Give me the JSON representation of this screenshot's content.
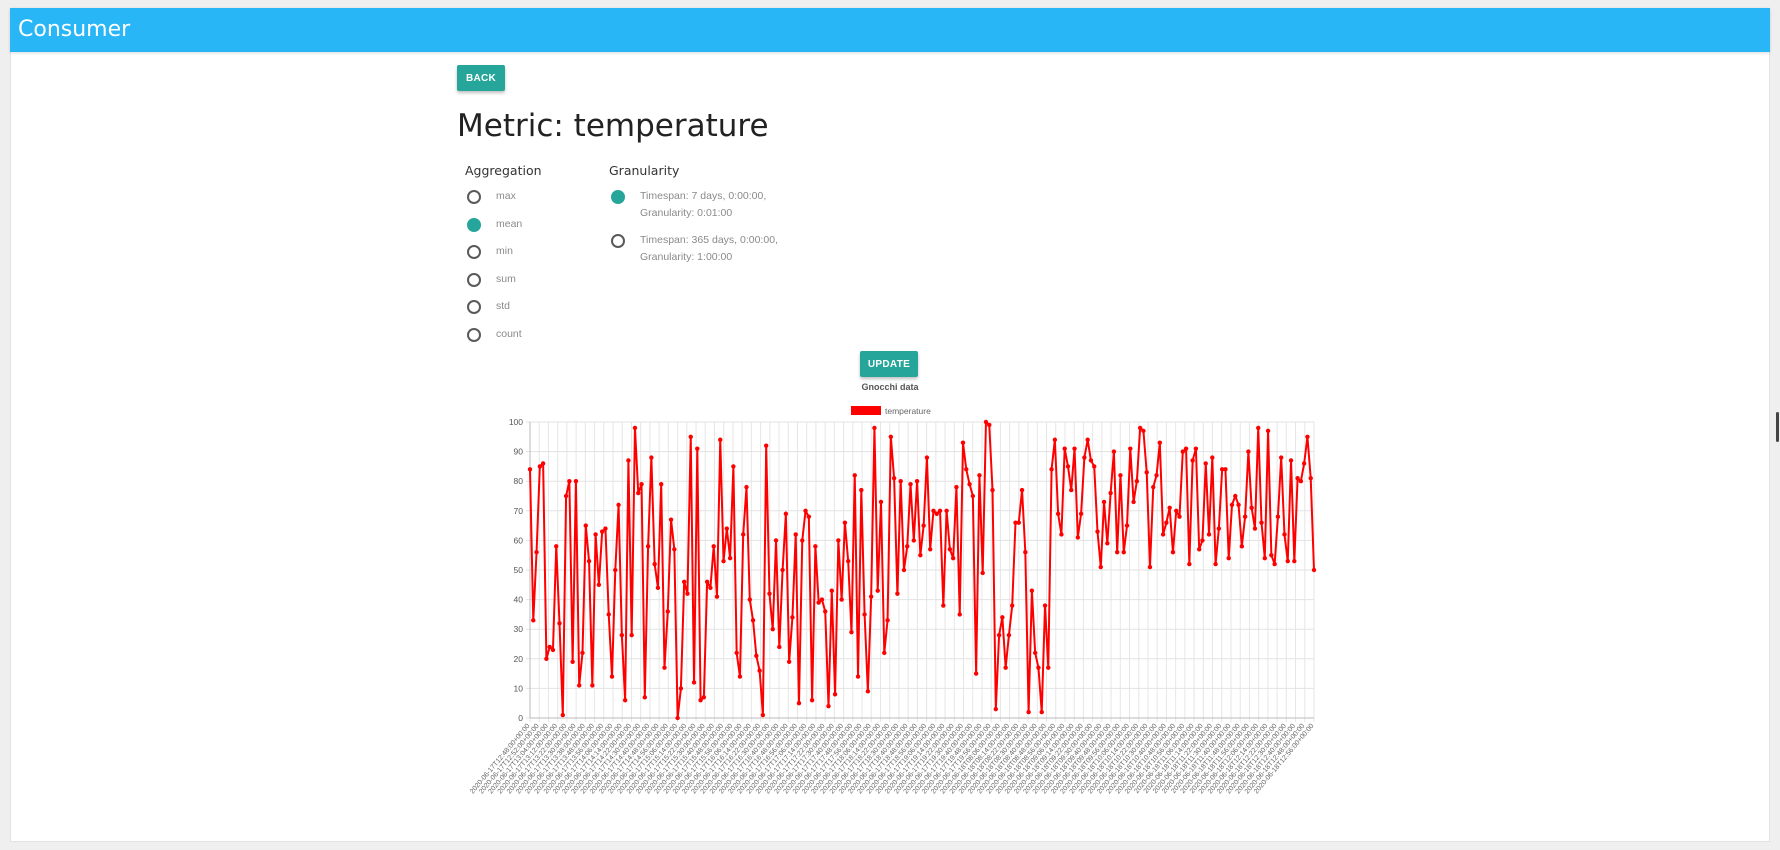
{
  "app": {
    "title": "Consumer"
  },
  "buttons": {
    "back": "BACK",
    "update": "UPDATE"
  },
  "page_title": "Metric: temperature",
  "aggregation": {
    "label": "Aggregation",
    "selected": "mean",
    "options": [
      "max",
      "mean",
      "min",
      "sum",
      "std",
      "count"
    ]
  },
  "granularity": {
    "label": "Granularity",
    "selected": 0,
    "options": [
      "Timespan: 7 days, 0:00:00, Granularity: 0:01:00",
      "Timespan: 365 days, 0:00:00, Granularity: 1:00:00"
    ]
  },
  "colors": {
    "topbar": "#29b6f6",
    "accent": "#26a69a",
    "series": "#ff0000"
  },
  "chart_data": {
    "type": "line",
    "title": "Gnocchi data",
    "legend": "top",
    "grid": true,
    "ylim": [
      0,
      100
    ],
    "yticks": [
      0,
      10,
      20,
      30,
      40,
      50,
      60,
      70,
      80,
      90,
      100
    ],
    "series": [
      {
        "name": "temperature",
        "color": "#ff0000",
        "values": [
          84,
          33,
          56,
          85,
          86,
          20,
          24,
          23,
          58,
          32,
          1,
          75,
          80,
          19,
          80,
          11,
          22,
          65,
          53,
          11,
          62,
          45,
          63,
          64,
          35,
          14,
          50,
          72,
          28,
          6,
          87,
          28,
          98,
          76,
          79,
          7,
          58,
          88,
          52,
          44,
          79,
          17,
          36,
          67,
          57,
          0,
          10,
          46,
          42,
          95,
          12,
          91,
          6,
          7,
          46,
          44,
          58,
          41,
          94,
          53,
          64,
          54,
          85,
          22,
          14,
          62,
          78,
          40,
          33,
          21,
          16,
          1,
          92,
          42,
          30,
          60,
          24,
          50,
          69,
          19,
          34,
          62,
          5,
          60,
          70,
          68,
          6,
          58,
          39,
          40,
          36,
          4,
          43,
          8,
          60,
          40,
          66,
          53,
          29,
          82,
          14,
          77,
          35,
          9,
          41,
          98,
          43,
          73,
          22,
          33,
          95,
          81,
          42,
          80,
          50,
          58,
          79,
          60,
          80,
          55,
          65,
          88,
          57,
          70,
          69,
          70,
          38,
          70,
          57,
          54,
          78,
          35,
          93,
          84,
          79,
          75,
          15,
          82,
          49,
          100,
          99,
          77,
          3,
          28,
          34,
          17,
          28,
          38,
          66,
          66,
          77,
          56,
          2,
          43,
          22,
          17,
          2,
          38,
          17,
          84,
          94,
          69,
          62,
          91,
          85,
          77,
          91,
          61,
          69,
          88,
          94,
          87,
          85,
          63,
          51,
          73,
          59,
          76,
          90,
          56,
          82,
          56,
          65,
          91,
          73,
          80,
          98,
          97,
          83,
          51,
          78,
          82,
          93,
          62,
          66,
          71,
          56,
          70,
          68,
          90,
          91,
          52,
          87,
          91,
          57,
          60,
          86,
          62,
          88,
          52,
          64,
          84,
          84,
          54,
          72,
          75,
          72,
          58,
          68,
          90,
          71,
          64,
          98,
          66,
          54,
          97,
          55,
          52,
          68,
          88,
          62,
          53,
          87,
          53,
          81,
          80,
          86,
          95,
          81,
          50
        ]
      }
    ],
    "x_labels": [
      "2020-06-17T12:48:00+00:00",
      "2020-06-17T12:52:00+00:00",
      "2020-06-17T13:04:00+00:00",
      "2020-06-17T13:12:00+00:00",
      "2020-06-17T13:22:00+00:00",
      "2020-06-17T13:30:00+00:00",
      "2020-06-17T13:38:00+00:00",
      "2020-06-17T13:48:00+00:00",
      "2020-06-17T13:56:00+00:00",
      "2020-06-17T14:06:00+00:00",
      "2020-06-17T14:14:00+00:00",
      "2020-06-17T14:22:00+00:00",
      "2020-06-17T14:30:00+00:00",
      "2020-06-17T14:40:00+00:00",
      "2020-06-17T14:48:00+00:00",
      "2020-06-17T14:56:00+00:00",
      "2020-06-17T15:06:00+00:00",
      "2020-06-17T15:14:00+00:00",
      "2020-06-17T15:22:00+00:00",
      "2020-06-17T15:30:00+00:00",
      "2020-06-17T15:40:00+00:00",
      "2020-06-17T15:48:00+00:00",
      "2020-06-17T15:56:00+00:00",
      "2020-06-17T16:06:00+00:00",
      "2020-06-17T16:14:00+00:00",
      "2020-06-17T16:22:00+00:00",
      "2020-06-17T16:30:00+00:00",
      "2020-06-17T16:40:00+00:00",
      "2020-06-17T16:48:00+00:00",
      "2020-06-17T16:56:00+00:00",
      "2020-06-17T17:06:00+00:00",
      "2020-06-17T17:14:00+00:00",
      "2020-06-17T17:22:00+00:00",
      "2020-06-17T17:30:00+00:00",
      "2020-06-17T17:40:00+00:00",
      "2020-06-17T17:48:00+00:00",
      "2020-06-17T17:56:00+00:00",
      "2020-06-17T18:06:00+00:00",
      "2020-06-17T18:14:00+00:00",
      "2020-06-17T18:22:00+00:00",
      "2020-06-17T18:30:00+00:00",
      "2020-06-17T18:40:00+00:00",
      "2020-06-17T18:48:00+00:00",
      "2020-06-17T18:56:00+00:00",
      "2020-06-17T19:06:00+00:00",
      "2020-06-17T19:14:00+00:00",
      "2020-06-17T19:22:00+00:00",
      "2020-06-17T19:30:00+00:00",
      "2020-06-17T19:40:00+00:00",
      "2020-06-17T19:48:00+00:00",
      "2020-06-17T19:56:00+00:00",
      "2020-06-18T08:06:00+00:00",
      "2020-06-18T08:14:00+00:00",
      "2020-06-18T08:22:00+00:00",
      "2020-06-18T08:30:00+00:00",
      "2020-06-18T08:40:00+00:00",
      "2020-06-18T08:48:00+00:00",
      "2020-06-18T08:56:00+00:00",
      "2020-06-18T09:06:00+00:00",
      "2020-06-18T09:14:00+00:00",
      "2020-06-18T09:22:00+00:00",
      "2020-06-18T09:30:00+00:00",
      "2020-06-18T09:40:00+00:00",
      "2020-06-18T09:48:00+00:00",
      "2020-06-18T09:56:00+00:00",
      "2020-06-18T10:06:00+00:00",
      "2020-06-18T10:14:00+00:00",
      "2020-06-18T10:22:00+00:00",
      "2020-06-18T10:30:00+00:00",
      "2020-06-18T10:40:00+00:00",
      "2020-06-18T10:48:00+00:00",
      "2020-06-18T10:56:00+00:00",
      "2020-06-18T11:06:00+00:00",
      "2020-06-18T11:14:00+00:00",
      "2020-06-18T11:22:00+00:00",
      "2020-06-18T11:30:00+00:00",
      "2020-06-18T11:40:00+00:00",
      "2020-06-18T11:48:00+00:00",
      "2020-06-18T11:56:00+00:00",
      "2020-06-18T12:06:00+00:00",
      "2020-06-18T12:14:00+00:00",
      "2020-06-18T12:22:00+00:00",
      "2020-06-18T12:30:00+00:00",
      "2020-06-18T12:40:00+00:00",
      "2020-06-18T12:48:00+00:00",
      "2020-06-18T12:56:00+00:00"
    ]
  }
}
